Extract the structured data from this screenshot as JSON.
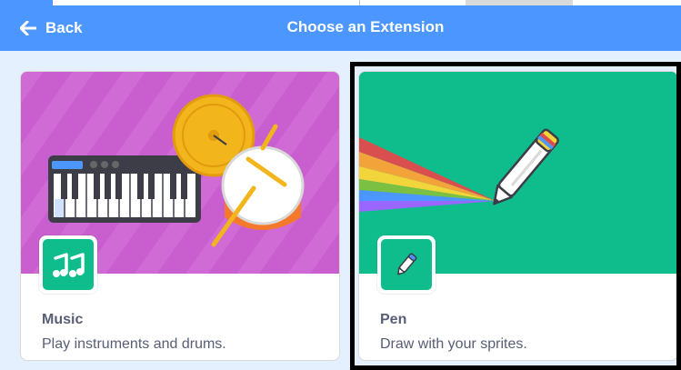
{
  "header": {
    "back_label": "Back",
    "title": "Choose an Extension"
  },
  "extensions": [
    {
      "name": "Music",
      "description": "Play instruments and drums.",
      "icon": "music-notes-icon",
      "art_color": "#c95fcf"
    },
    {
      "name": "Pen",
      "description": "Draw with your sprites.",
      "icon": "pen-icon",
      "art_color": "#0fbd8c",
      "selected": true
    }
  ],
  "colors": {
    "header": "#4c97ff",
    "background": "#e5f0ff",
    "icon_bg": "#0fbd8c",
    "text": "#575e75"
  }
}
